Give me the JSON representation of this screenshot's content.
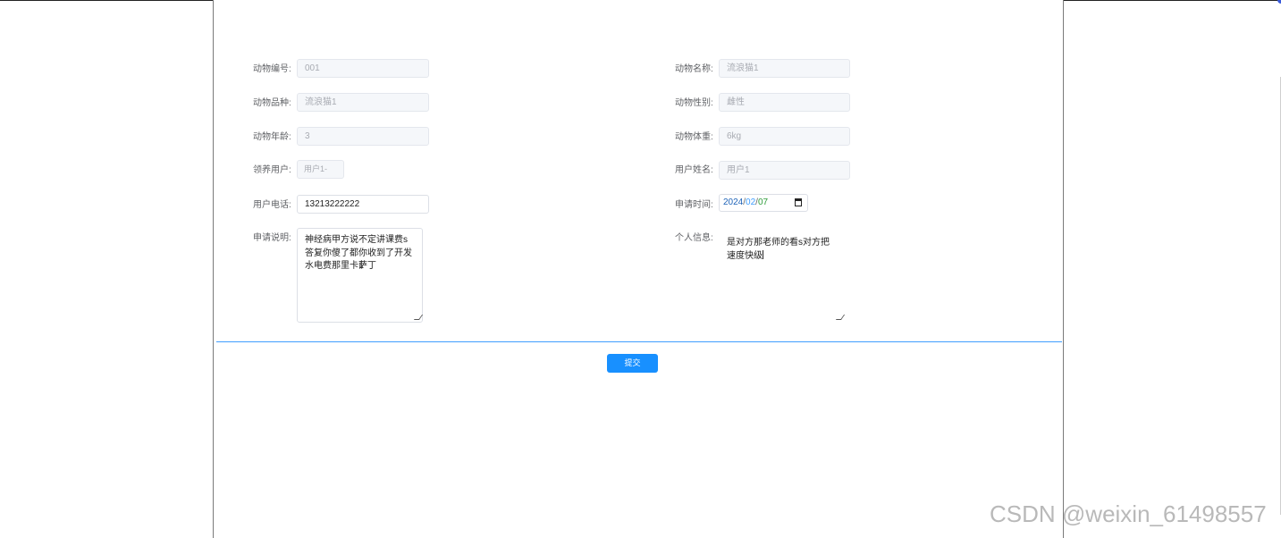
{
  "form": {
    "animal_id": {
      "label": "动物编号:",
      "value": "001"
    },
    "animal_name": {
      "label": "动物名称:",
      "value": "流浪猫1"
    },
    "animal_breed": {
      "label": "动物品种:",
      "value": "流浪猫1"
    },
    "animal_gender": {
      "label": "动物性别:",
      "value": "雌性"
    },
    "animal_age": {
      "label": "动物年龄:",
      "value": "3"
    },
    "animal_weight": {
      "label": "动物体重:",
      "value": "6kg"
    },
    "adopter_user": {
      "label": "领养用户:",
      "value": "用户1-"
    },
    "user_name": {
      "label": "用户姓名:",
      "value": "用户1"
    },
    "user_phone": {
      "label": "用户电话:",
      "value": "13213222222"
    },
    "apply_time": {
      "label": "申请时间:",
      "year": "2024",
      "month": "02",
      "day": "07",
      "separator": "/"
    },
    "apply_note": {
      "label": "申请说明:",
      "value": "神经病甲方说不定讲课费s答复你傻了都你收到了开发\n水电费那里卡萨丁"
    },
    "personal_info": {
      "label": "个人信息:",
      "value": "是对方那老师的看s对方把速度快级"
    }
  },
  "submit_label": "提交",
  "watermark": "CSDN @weixin_61498557",
  "colors": {
    "accent": "#409eff",
    "button": "#1890ff",
    "disabled_bg": "#f5f7fa",
    "label": "#606266"
  },
  "icons": {
    "calendar": "calendar-icon",
    "resize": "resize-handle-icon"
  }
}
